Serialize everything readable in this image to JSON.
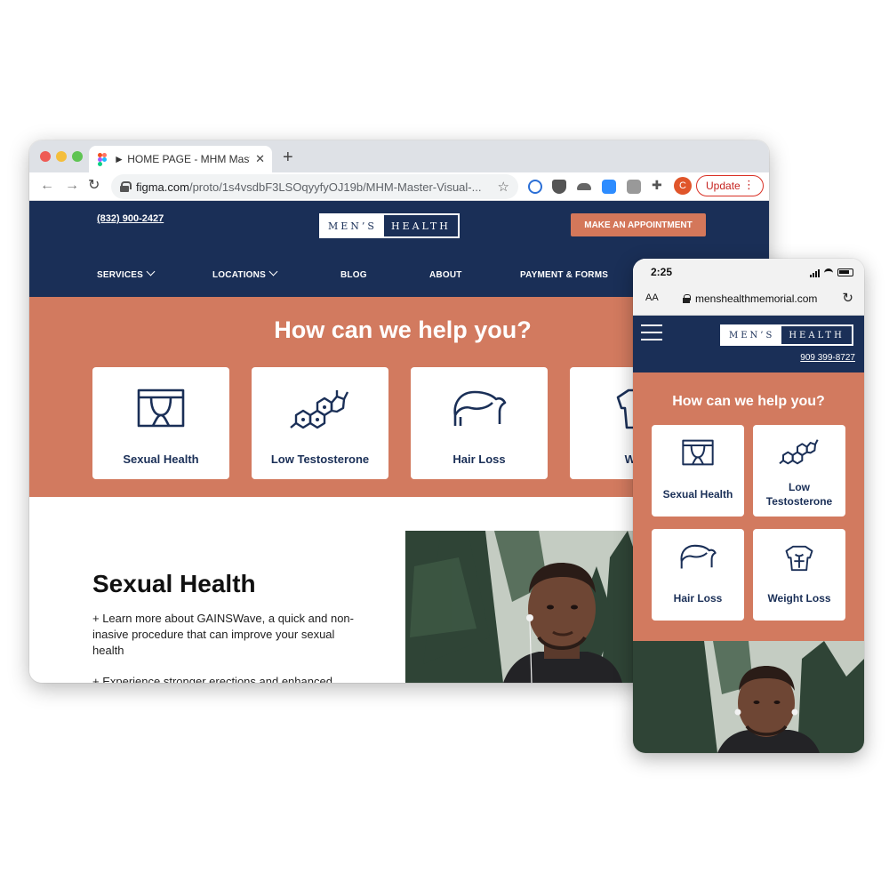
{
  "browser": {
    "tab_title": "► HOME PAGE - MHM Master",
    "tab_close": "✕",
    "new_tab": "+",
    "url_host": "figma.com",
    "url_path": "/proto/1s4vsdbF3LSOqyyfyOJ19b/MHM-Master-Visual-...",
    "profile_initial": "C",
    "update_label": "Update"
  },
  "site": {
    "phone": "(832) 900-2427",
    "logo_left": "MEN’S",
    "logo_right": "HEALTH",
    "cta": "MAKE AN APPOINTMENT",
    "nav": [
      "SERVICES",
      "LOCATIONS",
      "BLOG",
      "ABOUT",
      "PAYMENT & FORMS"
    ],
    "help_title": "How can we help you?",
    "cards": [
      "Sexual Health",
      "Low Testosterone",
      "Hair Loss",
      "Weig"
    ],
    "section_title": "Sexual Health",
    "para1": "+ Learn more about GAINSWave, a quick and non-inasive procedure that can improve your sexual health",
    "para2": "+ Experience stronger erections and enhanced"
  },
  "mobile": {
    "time": "2:25",
    "text_size": "AA",
    "url": "menshealthmemorial.com",
    "phone": "909 399-8727",
    "help_title": "How can we help you?",
    "cards": [
      "Sexual Health",
      "Low Testosterone",
      "Hair Loss",
      "Weight Loss"
    ]
  },
  "colors": {
    "navy": "#1a2f57",
    "terracotta": "#d27a5f",
    "cta": "#d4775a"
  }
}
